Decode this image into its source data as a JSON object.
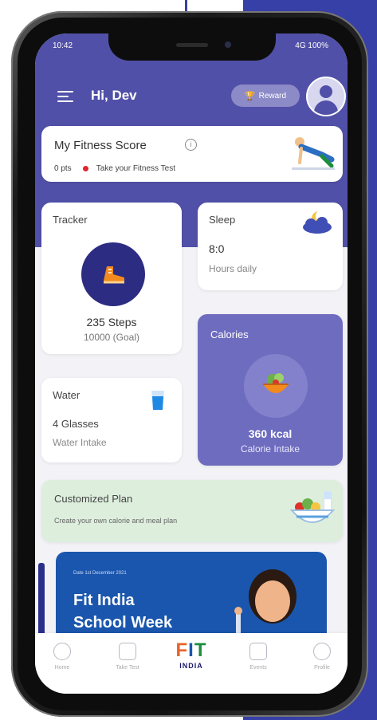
{
  "status": {
    "time": "10:42",
    "right": "4G 100%"
  },
  "header": {
    "greeting": "Hi, Dev",
    "reward_label": "Reward"
  },
  "fitness_score": {
    "title": "My Fitness Score",
    "points": "0 pts",
    "prompt": "Take your Fitness Test"
  },
  "tracker": {
    "label": "Tracker",
    "steps": "235 Steps",
    "goal": "10000 (Goal)"
  },
  "sleep": {
    "label": "Sleep",
    "value": "8:0",
    "sub": "Hours daily"
  },
  "calories": {
    "label": "Calories",
    "value": "360 kcal",
    "sub": "Calorie Intake"
  },
  "water": {
    "label": "Water",
    "value": "4 Glasses",
    "sub": "Water Intake"
  },
  "plan": {
    "title": "Customized Plan",
    "sub": "Create your own calorie and meal plan"
  },
  "banner": {
    "small": "Date 1st December 2021",
    "title_line1": "Fit India",
    "title_line2": "School Week"
  },
  "bottom_nav": {
    "items": [
      {
        "label": "Home",
        "icon": "home-icon"
      },
      {
        "label": "Take Test",
        "icon": "clipboard-icon"
      },
      {
        "label": "Events",
        "icon": "calendar-icon"
      },
      {
        "label": "Profile",
        "icon": "profile-icon"
      }
    ],
    "logo_top": "FIT",
    "logo_bottom": "INDIA"
  },
  "colors": {
    "primary": "#5150a8",
    "calories_card": "#6e6cbf",
    "plan_card": "#ddeedd",
    "banner": "#1a56ad"
  }
}
